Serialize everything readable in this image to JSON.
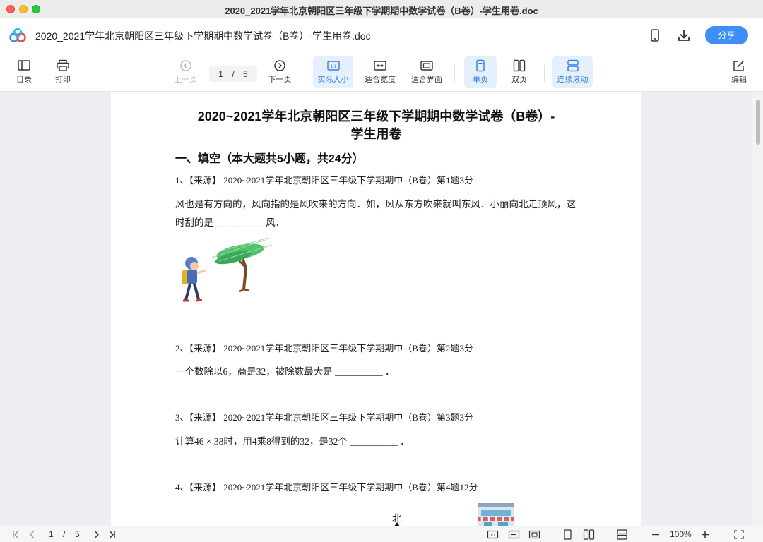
{
  "window": {
    "title": "2020_2021学年北京朝阳区三年级下学期期中数学试卷（B卷）-学生用卷.doc"
  },
  "header": {
    "doc_title": "2020_2021学年北京朝阳区三年级下学期期中数学试卷（B卷）-学生用卷.doc",
    "share_label": "分享",
    "icons": [
      "logo-icon",
      "phone-icon",
      "download-icon"
    ]
  },
  "toolbar": {
    "toc_label": "目录",
    "print_label": "打印",
    "prev_label": "上一页",
    "page_current": "1",
    "page_sep": "/",
    "page_total": "5",
    "next_label": "下一页",
    "actual_size_label": "实际大小",
    "fit_width_label": "适合宽度",
    "fit_page_label": "适合界面",
    "single_page_label": "单页",
    "double_page_label": "双页",
    "continuous_label": "连续滚动",
    "edit_label": "编辑",
    "actual_size_glyph": "1:1",
    "accent": "#2f7de6"
  },
  "document": {
    "title_line1": "2020~2021学年北京朝阳区三年级下学期期中数学试卷（B卷）-",
    "title_line2": "学生用卷",
    "section1": "一、填空（本大题共5小题，共24分）",
    "questions": [
      {
        "source": "1、【来源】 2020~2021学年北京朝阳区三年级下学期期中（B卷）第1题3分",
        "line1": "风也是有方向的，风向指的是风吹来的方向．如，风从东方吹来就叫东风．小丽向北走顶风，这",
        "line2": "时刮的是 __________ 风．"
      },
      {
        "source": "2、【来源】 2020~2021学年北京朝阳区三年级下学期期中（B卷）第2题3分",
        "line1": "一个数除以6，商是32，被除数最大是 __________ ．"
      },
      {
        "source": "3、【来源】 2020~2021学年北京朝阳区三年级下学期期中（B卷）第3题3分",
        "line1": "计算46 × 38时，用4乘8得到的32，是32个 __________ ．"
      },
      {
        "source": "4、【来源】 2020~2021学年北京朝阳区三年级下学期期中（B卷）第4题12分",
        "north_label": "北"
      }
    ]
  },
  "bottombar": {
    "page_current": "1",
    "page_sep": "/",
    "page_total": "5",
    "zoom": "100%",
    "actual_size_glyph": "1:1"
  }
}
